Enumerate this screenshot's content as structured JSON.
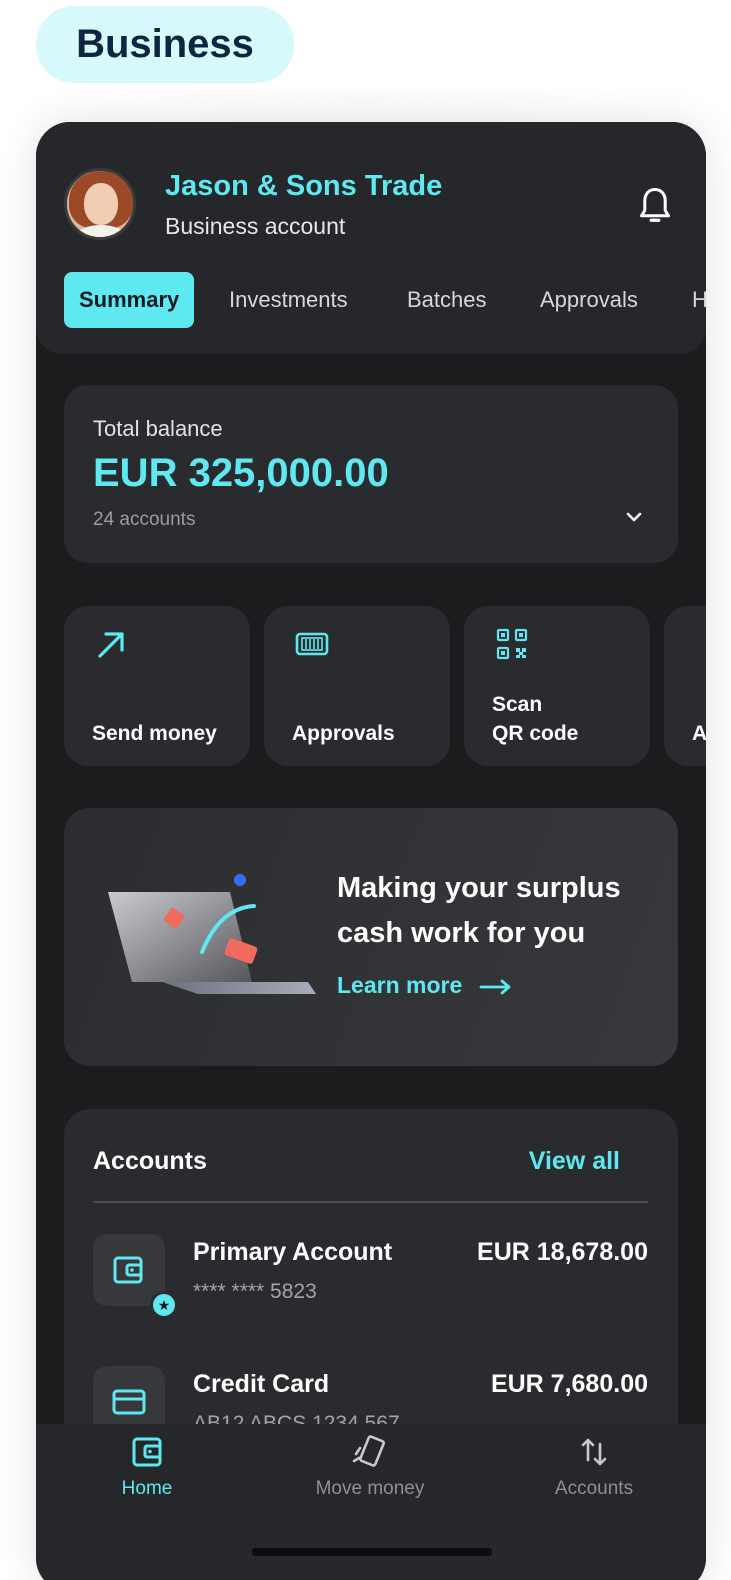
{
  "badge": {
    "label": "Business"
  },
  "header": {
    "company": "Jason & Sons Trade",
    "account_type": "Business account",
    "avatar": "user-avatar",
    "bell_icon": "bell-icon"
  },
  "tabs": [
    {
      "label": "Summary",
      "active": true
    },
    {
      "label": "Investments"
    },
    {
      "label": "Batches"
    },
    {
      "label": "Approvals"
    },
    {
      "label": "H"
    }
  ],
  "balance": {
    "label": "Total balance",
    "value": "EUR 325,000.00",
    "sub": "24 accounts"
  },
  "actions": [
    {
      "label": "Send money",
      "icon": "arrow-up-right-icon"
    },
    {
      "label": "Approvals",
      "icon": "approvals-icon"
    },
    {
      "label_line1": "Scan",
      "label_line2": "QR code",
      "icon": "qr-code-icon"
    },
    {
      "label": "A"
    }
  ],
  "promo": {
    "title": "Making your surplus cash work for you",
    "link": "Learn more"
  },
  "accounts": {
    "title": "Accounts",
    "view_all": "View all",
    "items": [
      {
        "name": "Primary Account",
        "number": "**** **** 5823",
        "amount": "EUR 18,678.00",
        "icon": "wallet-icon"
      },
      {
        "name": "Credit Card",
        "number": "AB12 ABCS 1234 567",
        "amount": "EUR 7,680.00",
        "icon": "credit-card-icon"
      }
    ]
  },
  "nav": [
    {
      "label": "Home",
      "active": true,
      "icon": "home-wallet-icon"
    },
    {
      "label": "Move money",
      "icon": "move-money-icon"
    },
    {
      "label": "Accounts",
      "icon": "transfer-arrows-icon"
    }
  ],
  "colors": {
    "accent": "#5ee8ef",
    "surface": "#2a2b2e",
    "background": "#1b1c1e"
  }
}
